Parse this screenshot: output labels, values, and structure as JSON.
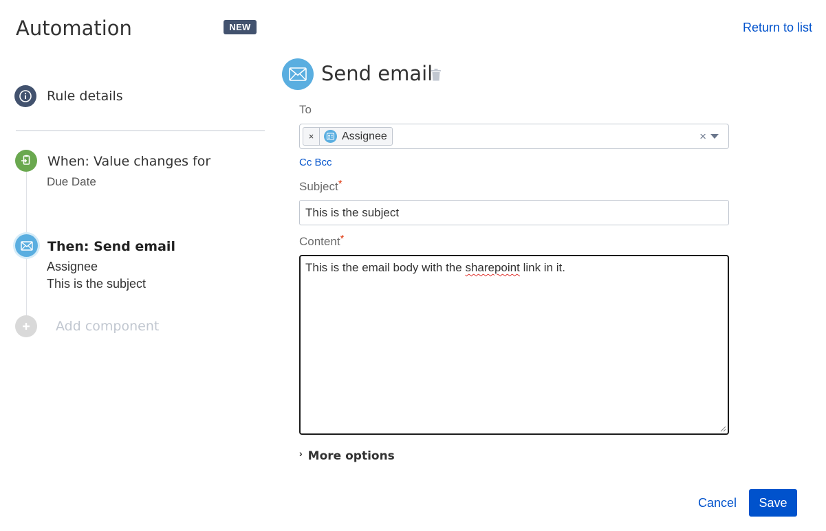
{
  "header": {
    "title": "Automation",
    "badge": "NEW",
    "return_link": "Return to list"
  },
  "sidebar": {
    "rule_details": "Rule details",
    "trigger": {
      "title": "When: Value changes for",
      "subtitle": "Due Date"
    },
    "action": {
      "title": "Then: Send email",
      "line1": "Assignee",
      "line2": "This is the subject"
    },
    "add_component": "Add component"
  },
  "panel": {
    "title": "Send email",
    "to": {
      "label": "To",
      "chips": [
        {
          "remove": "×",
          "label": "Assignee"
        }
      ],
      "clear": "×"
    },
    "cc_bcc": "Cc Bcc",
    "subject": {
      "label": "Subject",
      "required": "*",
      "value": "This is the subject"
    },
    "content": {
      "label": "Content",
      "required": "*",
      "text_before": "This is the email body with the ",
      "misspelled": "sharepoint",
      "text_after": " link in it."
    },
    "more_options": {
      "chevron": "›",
      "label": "More options"
    }
  },
  "footer": {
    "cancel": "Cancel",
    "save": "Save"
  },
  "colors": {
    "primary": "#0052cc",
    "badge_bg": "#42526e",
    "trigger_green": "#6aa84f",
    "action_blue": "#5aaee0",
    "required_red": "#de350b"
  }
}
